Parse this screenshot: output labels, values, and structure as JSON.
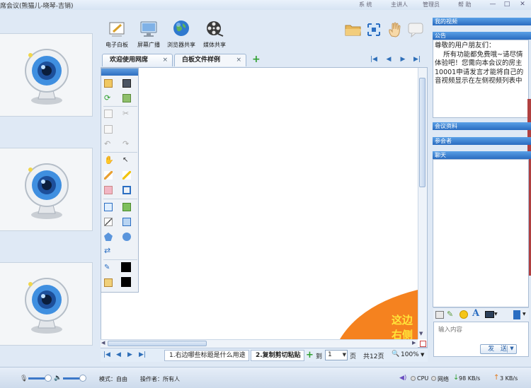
{
  "window": {
    "title": "席会议(熊猫儿-晓琴-吉销)",
    "menu": [
      "系 统",
      "主讲人",
      "管理员",
      "帮 助"
    ]
  },
  "toolbar": {
    "items": [
      {
        "label": "电子白板",
        "icon": "whiteboard-icon"
      },
      {
        "label": "屏幕广播",
        "icon": "monitor-icon"
      },
      {
        "label": "浏览器共享",
        "icon": "globe-icon"
      },
      {
        "label": "媒体共享",
        "icon": "film-reel-icon"
      }
    ],
    "right_icons": [
      "folder-icon",
      "fullscreen-icon",
      "hand-icon",
      "chat-bubble-icon"
    ]
  },
  "tabs": [
    {
      "label": "欢迎使用网席",
      "active": true
    },
    {
      "label": "白板文件样例",
      "active": false
    }
  ],
  "canvas": {
    "corner_text_1": "这边",
    "corner_text_2": "右侧"
  },
  "page_bar": {
    "page_tabs": [
      "1.右边哪些标题是什么用途",
      "2.复制剪切粘贴"
    ],
    "goto_label": "到",
    "page_value": "1",
    "page_unit": "页",
    "total": "共12页",
    "zoom": "100%"
  },
  "status": {
    "mode": "模式：自由",
    "operator": "操作者：所有人",
    "cpu": "CPU",
    "network": "网络",
    "down": "98 KB/s",
    "up": "3 KB/s"
  },
  "right_panel": {
    "my_video": "我的视频",
    "notice": "公告",
    "notice_text": "尊敬的用户朋友们：\n    所有功能都免费哦~请尽情体验吧！您需向本会议的房主10001申请发言才能将自己的音视频显示在左侧视频列表中",
    "materials": "会议资料",
    "participants": "参会者",
    "chat": "聊天",
    "chat_placeholder": "输入内容",
    "send": "发 送"
  },
  "colors": {
    "accent": "#2a6cc0",
    "orange": "#f5821f",
    "corner_text": "#ffe43a"
  }
}
